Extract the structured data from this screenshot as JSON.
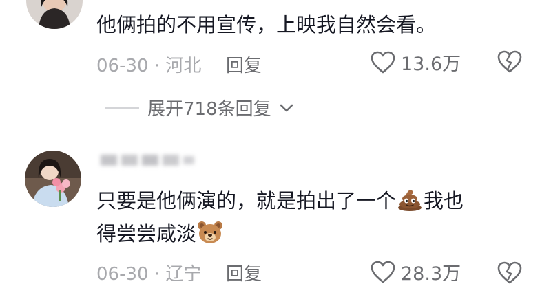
{
  "comments": [
    {
      "username": "",
      "text_lines": [
        "他俩拍的不用宣传，上映我自然会看。"
      ],
      "meta": "06-30 · 河北",
      "reply_label": "回复",
      "likes": "13.6万"
    },
    {
      "username": "",
      "text_lines": [
        "只要是他俩演的，就是拍出了一个",
        "我也",
        "得尝尝咸淡"
      ],
      "meta": "06-30 · 辽宁",
      "reply_label": "回复",
      "likes": "28.3万"
    }
  ],
  "expand_replies": "展开718条回复",
  "icons": {
    "like": "heart-outline-icon",
    "dislike": "broken-heart-icon",
    "expand": "chevron-down-icon",
    "emoji_1": "poop-emoji-icon",
    "emoji_2": "bear-face-emoji-icon"
  },
  "colors": {
    "text": "#161823",
    "meta": "#a8a9ad",
    "action": "#6b6c70"
  }
}
